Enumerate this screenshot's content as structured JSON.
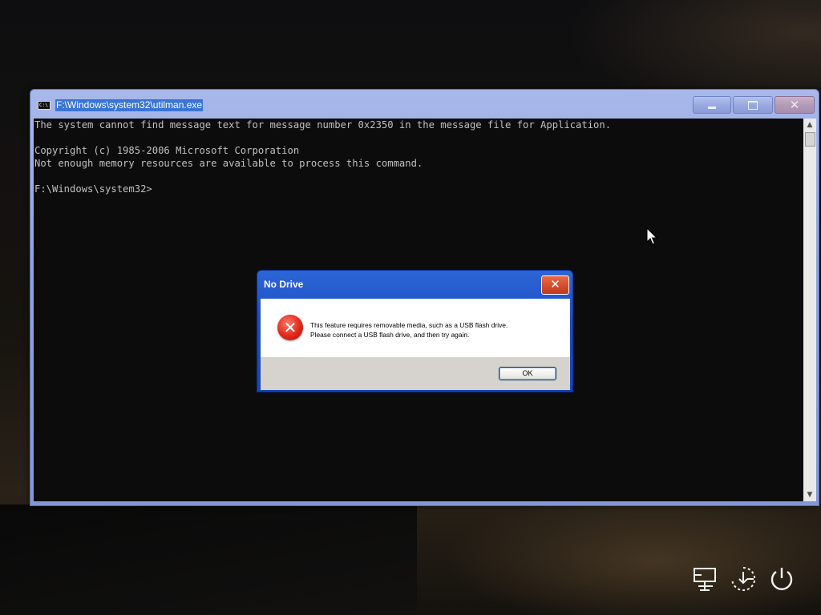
{
  "console": {
    "title": "F:\\Windows\\system32\\utilman.exe",
    "icon_text": "C:\\",
    "lines": [
      "The system cannot find message text for message number 0x2350 in the message file for Application.",
      "",
      "Copyright (c) 1985-2006 Microsoft Corporation",
      "Not enough memory resources are available to process this command.",
      "",
      "F:\\Windows\\system32>"
    ],
    "close_symbol": "✕"
  },
  "dialog": {
    "title": "No Drive",
    "close_symbol": "✕",
    "icon": "error-icon",
    "message_line1": "This feature requires removable media, such as a USB flash drive.",
    "message_line2": "Please connect a USB flash drive, and then try again.",
    "ok_label": "OK"
  },
  "taskbar_icons": [
    "network-icon",
    "ease-of-access-icon",
    "power-icon"
  ]
}
